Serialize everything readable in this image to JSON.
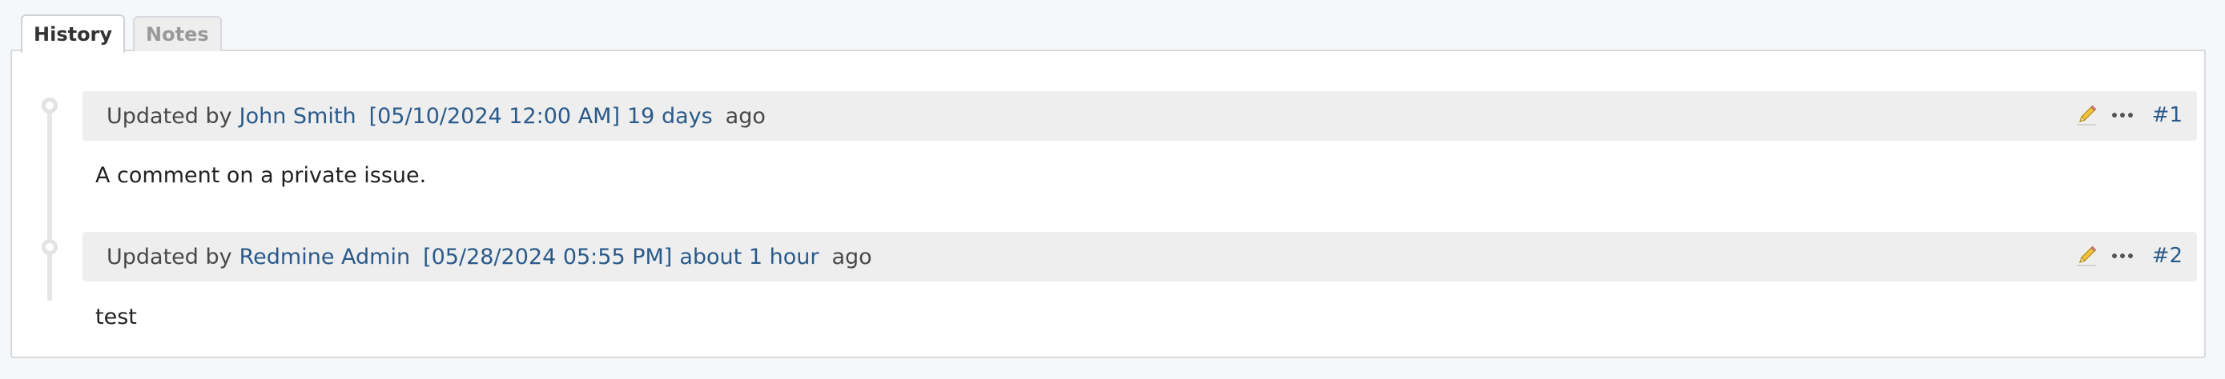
{
  "tabs": [
    {
      "label": "History",
      "selected": true
    },
    {
      "label": "Notes",
      "selected": false
    }
  ],
  "journals": [
    {
      "prefix": "Updated by",
      "author": "John Smith",
      "timestamp": "[05/10/2024 12:00 AM]",
      "relative": "19 days",
      "suffix": "ago",
      "note_number": "#1",
      "note": "A comment on a private issue."
    },
    {
      "prefix": "Updated by",
      "author": "Redmine Admin",
      "timestamp": "[05/28/2024 05:55 PM]",
      "relative": "about 1 hour",
      "suffix": "ago",
      "note_number": "#2",
      "note": "test"
    }
  ],
  "icons": {
    "edit": "pencil-icon",
    "more": "ellipsis-icon"
  },
  "colors": {
    "link": "#2a5a8a",
    "header_background": "#eeeeee",
    "panel_border": "#d6d9de"
  }
}
